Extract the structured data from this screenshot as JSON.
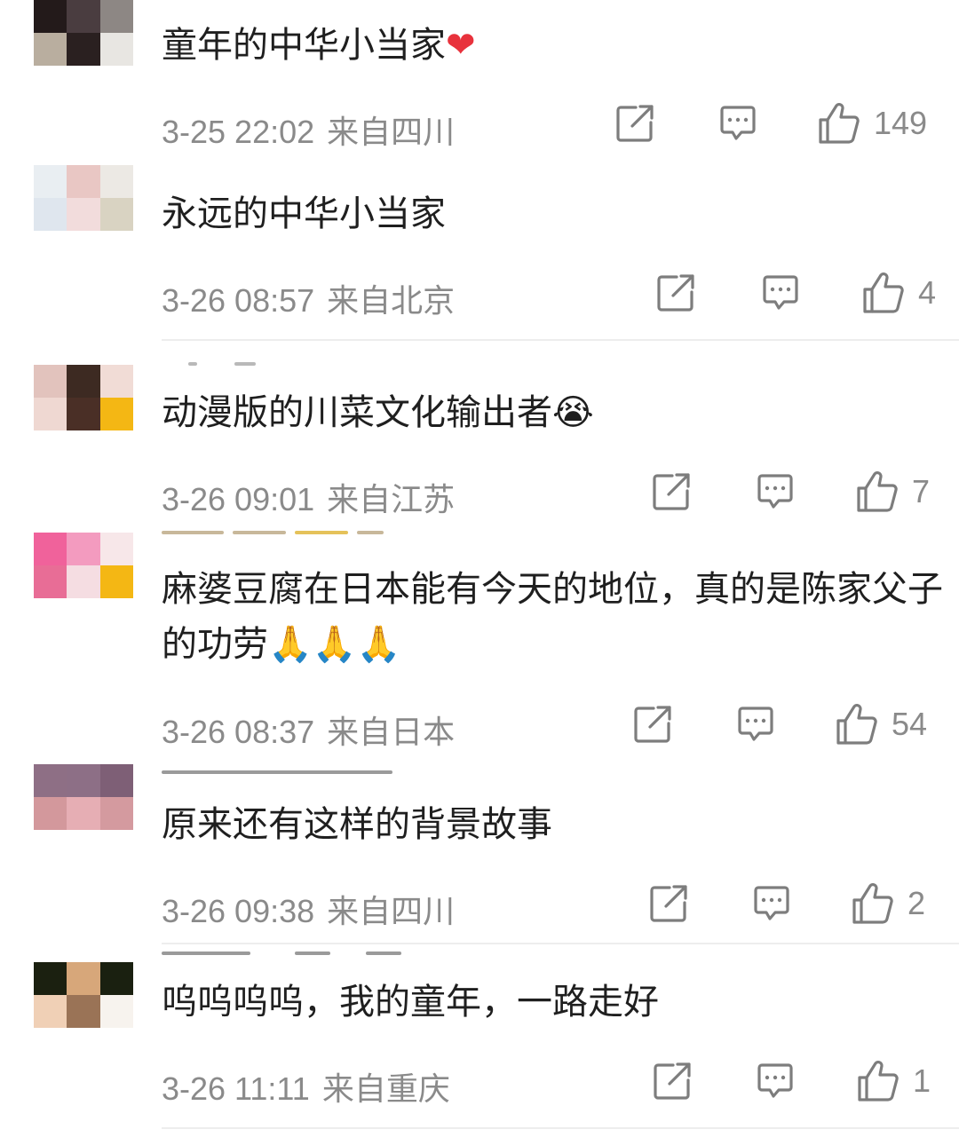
{
  "comments": [
    {
      "text": "童年的中华小当家",
      "emoji": "❤",
      "time": "3-25 22:02",
      "location": "来自四川",
      "likes": "149",
      "avatar_colors": [
        "#231a1a",
        "#4a3d40",
        "#8d8784",
        "#b9ae9f",
        "#2a2020",
        "#e8e6e2"
      ]
    },
    {
      "text": "永远的中华小当家",
      "emoji": "",
      "time": "3-26 08:57",
      "location": "来自北京",
      "likes": "4",
      "avatar_colors": [
        "#e9eef2",
        "#e9c7c4",
        "#ece9e4",
        "#dfe6ee",
        "#f2dcdc",
        "#d9d3c2"
      ]
    },
    {
      "text": "动漫版的川菜文化输出者",
      "emoji": "😭",
      "time": "3-26 09:01",
      "location": "来自江苏",
      "likes": "7",
      "avatar_colors": [
        "#e2c3bd",
        "#3d2a22",
        "#f1dcd6",
        "#efd8d2",
        "#4a2f26",
        "#f4b714"
      ]
    },
    {
      "text": "麻婆豆腐在日本能有今天的地位，真的是陈家父子的功劳",
      "emoji": "🙏🙏🙏",
      "time": "3-26 08:37",
      "location": "来自日本",
      "likes": "54",
      "avatar_colors": [
        "#f0629b",
        "#f39bbf",
        "#f7e7e9",
        "#e86d96",
        "#f5dde2",
        "#f4b714"
      ]
    },
    {
      "text": "原来还有这样的背景故事",
      "emoji": "",
      "time": "3-26 09:38",
      "location": "来自四川",
      "likes": "2",
      "avatar_colors": [
        "#8e6f85",
        "#8d6f86",
        "#7e5f76",
        "#d3989c",
        "#e6aeb4",
        "#d49a9f"
      ]
    },
    {
      "text": "呜呜呜呜，我的童年，一路走好",
      "emoji": "",
      "time": "3-26 11:11",
      "location": "来自重庆",
      "likes": "1",
      "avatar_colors": [
        "#1b2010",
        "#d7a77a",
        "#1a2010",
        "#f0d0b6",
        "#9a7356",
        "#f7f3ee"
      ]
    }
  ],
  "colors": {
    "text": "#1f1f1f",
    "meta": "#8a8a8a",
    "divider": "#ededed"
  },
  "icons": {
    "share": "share-icon",
    "comment": "comment-icon",
    "like": "thumbs-up-icon"
  }
}
